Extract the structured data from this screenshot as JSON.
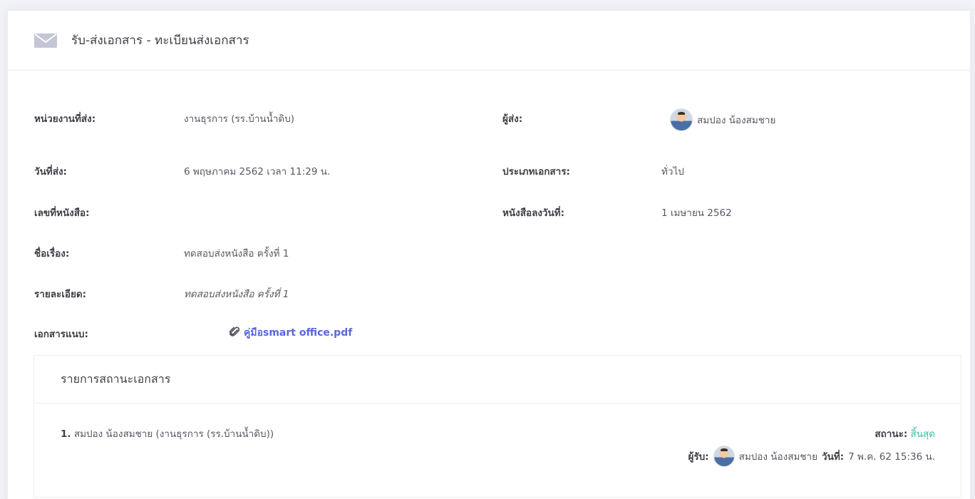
{
  "header": {
    "icon": "envelope-icon",
    "title": "รับ-ส่งเอกสาร - ทะเบียนส่งเอกสาร"
  },
  "fields": {
    "sender_unit_label": "หน่วยงานที่ส่ง:",
    "sender_unit_value": "งานธุรการ (รร.บ้านน้ำดิบ)",
    "sender_label": "ผู้ส่ง:",
    "sender_value": "สมปอง น้องสมชาย",
    "send_date_label": "วันที่ส่ง:",
    "send_date_value": "6 พฤษภาคม 2562 เวลา 11:29 น.",
    "doc_type_label": "ประเภทเอกสาร:",
    "doc_type_value": "ทั่วไป",
    "doc_number_label": "เลขที่หนังสือ:",
    "doc_number_value": "",
    "doc_date_label": "หนังสือลงวันที่:",
    "doc_date_value": "1 เมษายน 2562",
    "subject_label": "ชื่อเรื่อง:",
    "subject_value": "ทดสอบส่งหนังสือ ครั้งที่ 1",
    "detail_label": "รายละเอียด:",
    "detail_value": "ทดสอบส่งหนังสือ ครั้งที่ 1",
    "attachment_label": "เอกสารแนบ:",
    "attachment_value": "คู่มือsmart office.pdf"
  },
  "status_list": {
    "title": "รายการสถานะเอกสาร",
    "items": [
      {
        "index": "1.",
        "entry": "สมปอง น้องสมชาย (งานธุรการ (รร.บ้านน้ำดิบ))",
        "status_label": "สถานะ:",
        "status_value": "สิ้นสุด",
        "receiver_label": "ผู้รับ:",
        "receiver_name": "สมปอง น้องสมชาย",
        "date_label": "วันที่:",
        "date_value": "7 พ.ค. 62 15:36 น."
      }
    ]
  },
  "colors": {
    "link": "#5867dd",
    "status_done": "#34bfa3"
  }
}
